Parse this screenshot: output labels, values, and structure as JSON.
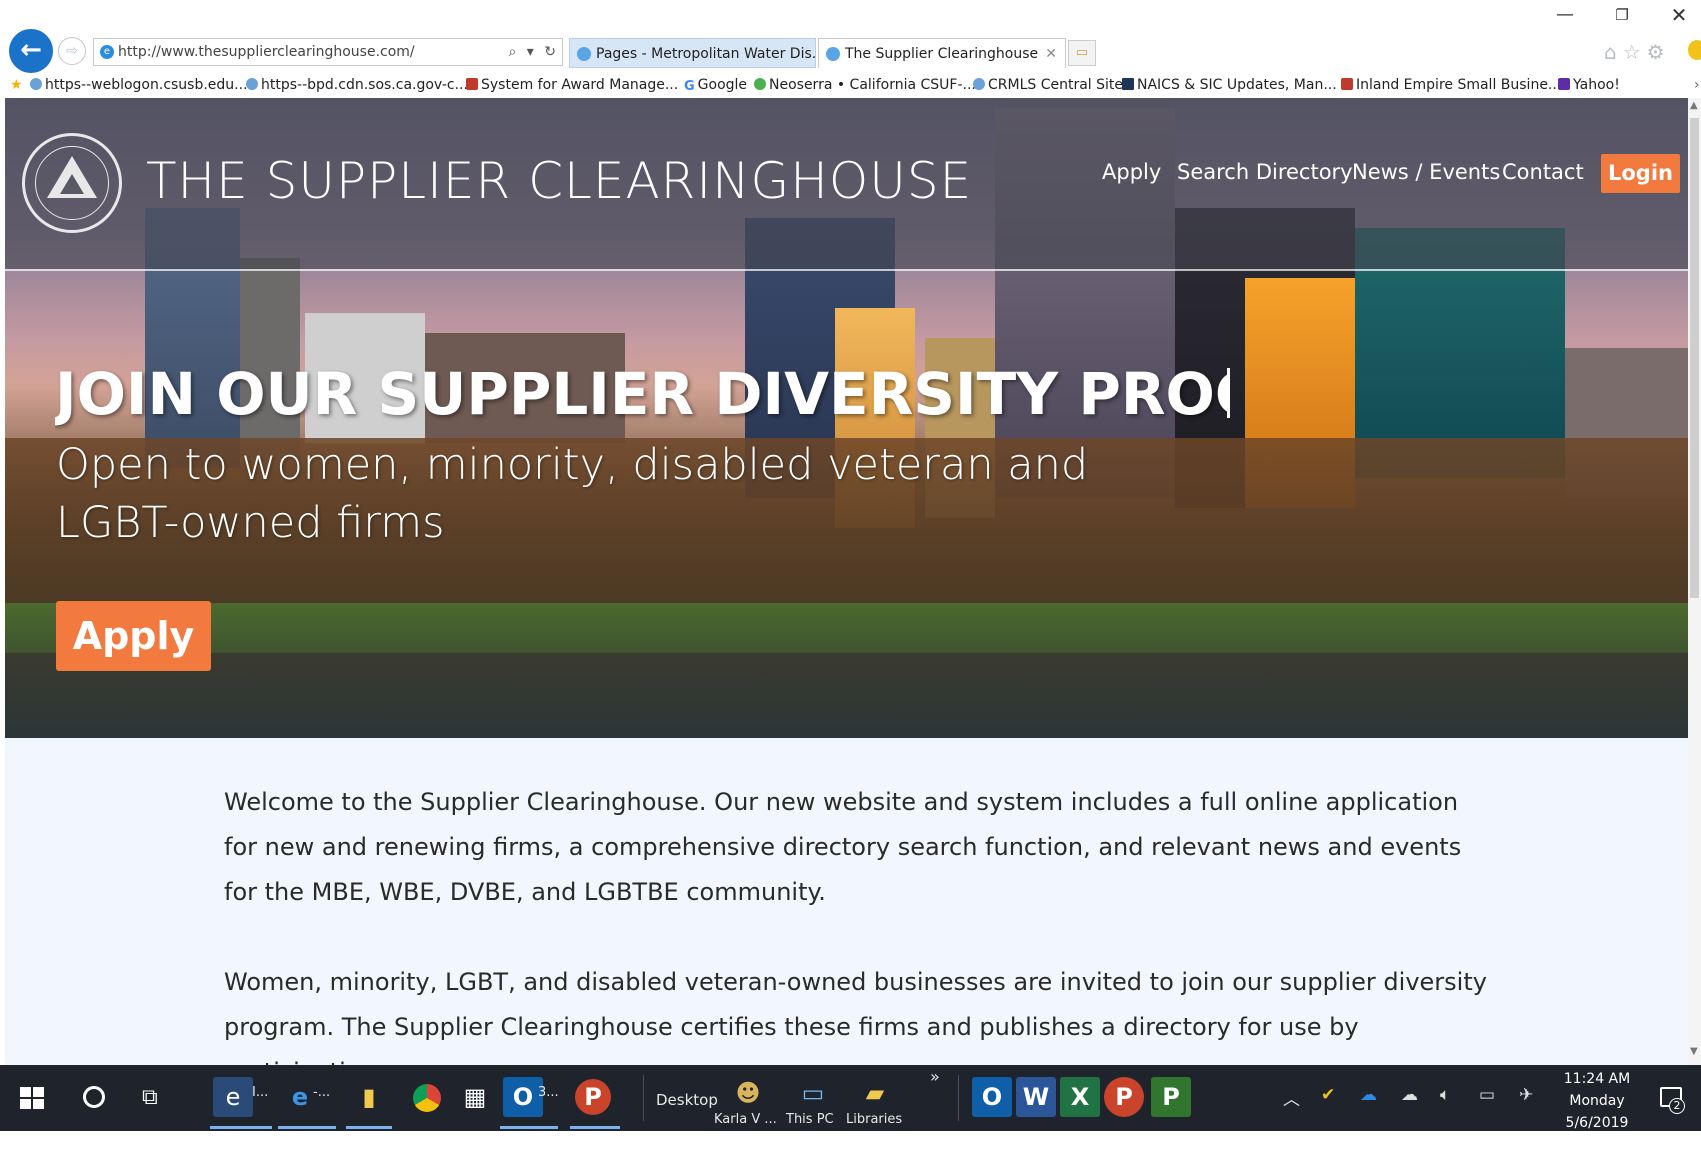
{
  "window": {
    "minimize": "—",
    "restore": "❐",
    "close": "✕"
  },
  "browser": {
    "back_icon": "←",
    "forward_icon": "⇨",
    "address": "http://www.thesupplierclearinghouse.com/",
    "address_tools": {
      "search": "⌕",
      "dropdown": "▾",
      "refresh": "↻"
    },
    "tabs": [
      {
        "label": "Pages - Metropolitan Water Dis...",
        "active": false
      },
      {
        "label": "The Supplier Clearinghouse",
        "active": true,
        "close": "✕"
      }
    ],
    "new_tab": "▭",
    "toolbar_icons": "⌂☆⚙"
  },
  "favorites": [
    {
      "label": "https--weblogon.csusb.edu..."
    },
    {
      "label": "https--bpd.cdn.sos.ca.gov-c..."
    },
    {
      "label": "System for Award Manage..."
    },
    {
      "label": "Google"
    },
    {
      "label": "Neoserra • California CSUF-..."
    },
    {
      "label": "CRMLS Central Site"
    },
    {
      "label": "NAICS & SIC Updates, Man..."
    },
    {
      "label": "Inland Empire Small Busine..."
    },
    {
      "label": "Yahoo!"
    }
  ],
  "site": {
    "title": "THE SUPPLIER CLEARINGHOUSE",
    "nav": {
      "apply": "Apply",
      "search": "Search Directory",
      "news": "News / Events",
      "contact": "Contact",
      "login": "Login"
    },
    "hero": {
      "heading": "JOIN OUR SUPPLIER DIVERSITY PROGRAM",
      "subheading": "Open to women, minority, disabled veteran and LGBT-owned firms",
      "apply_button": "Apply"
    },
    "content": {
      "paragraph1": "Welcome to the Supplier Clearinghouse. Our new website and system includes a full online application for new and renewing firms, a comprehensive directory search function, and relevant news and events for the MBE, WBE, DVBE, and LGBTBE community.",
      "paragraph2": "Women, minority, LGBT, and disabled veteran-owned businesses are invited to join our supplier diversity program. The Supplier Clearinghouse certifies these firms and publishes a directory for use by participating"
    }
  },
  "taskbar": {
    "apps": [
      {
        "name": "Internet Explorer",
        "label": "I..."
      },
      {
        "name": "Edge",
        "label": "-..."
      },
      {
        "name": "File Explorer",
        "label": ""
      },
      {
        "name": "Chrome",
        "label": ""
      },
      {
        "name": "Calculator",
        "label": ""
      },
      {
        "name": "Outlook",
        "label": "3..."
      },
      {
        "name": "PowerPoint",
        "label": ""
      }
    ],
    "desktop_label": "Desktop",
    "folders": [
      {
        "label": "Karla V ..."
      },
      {
        "label": "This PC"
      },
      {
        "label": "Libraries"
      }
    ],
    "overflow": "»",
    "pinned_office": [
      "O",
      "W",
      "X",
      "P",
      "P"
    ],
    "clock": {
      "time": "11:24 AM",
      "day": "Monday",
      "date": "5/6/2019"
    },
    "notifications": "2",
    "accent": "#f37a3e"
  }
}
